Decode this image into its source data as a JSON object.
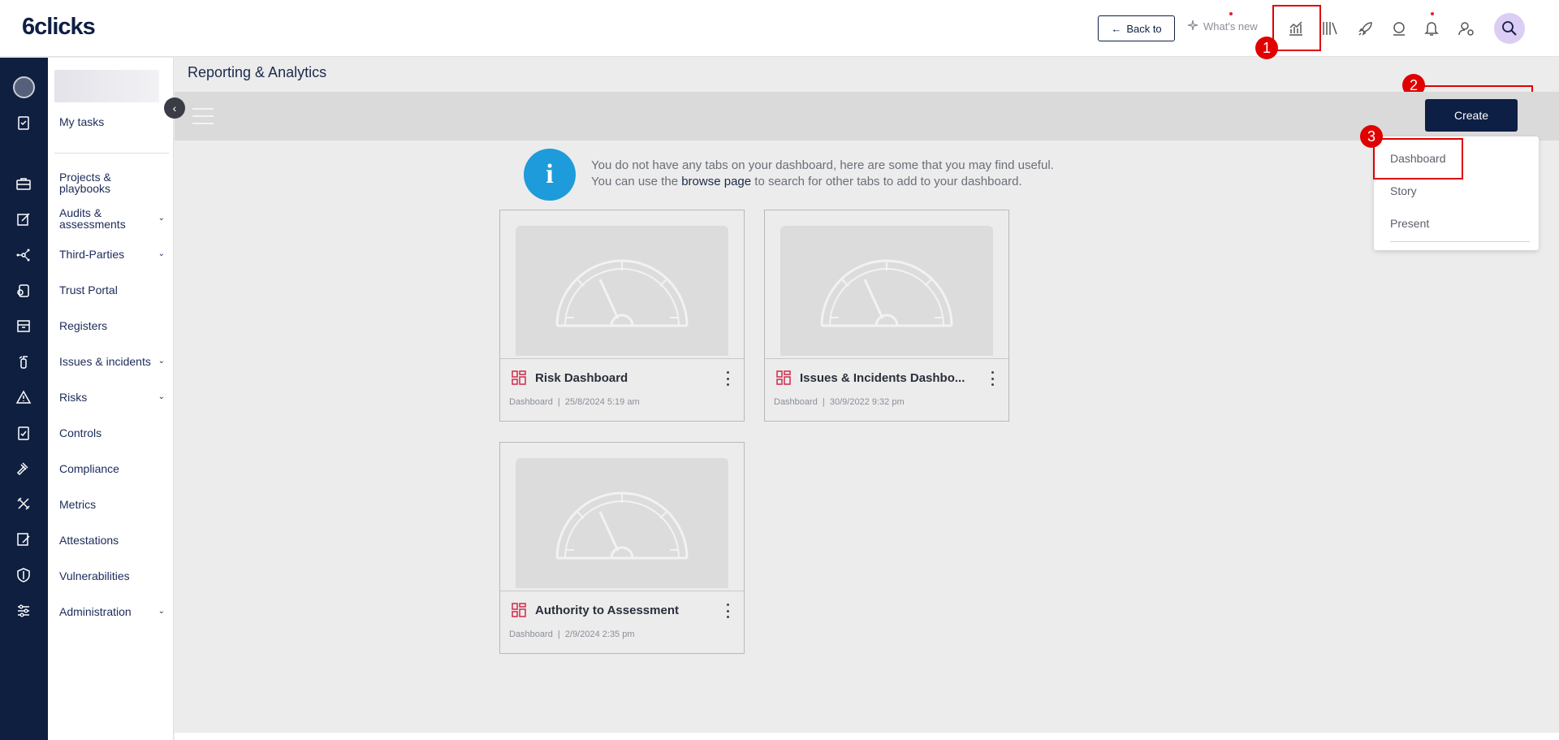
{
  "header": {
    "logo": "6clicks",
    "back_label": "Back to",
    "whats_new_label": "What's new",
    "icons": [
      "analytics-icon",
      "library-icon",
      "rocket-icon",
      "support-icon",
      "bell-icon",
      "user-settings-icon",
      "global-search-icon"
    ]
  },
  "annotations": {
    "n1": "1",
    "n2": "2",
    "n3": "3"
  },
  "sidebar": {
    "items": [
      {
        "label": "My tasks"
      },
      {
        "label": "Projects & playbooks"
      },
      {
        "label": "Audits & assessments"
      },
      {
        "label": "Third-Parties"
      },
      {
        "label": "Trust Portal"
      },
      {
        "label": "Registers"
      },
      {
        "label": "Issues & incidents"
      },
      {
        "label": "Risks"
      },
      {
        "label": "Controls"
      },
      {
        "label": "Compliance"
      },
      {
        "label": "Metrics"
      },
      {
        "label": "Attestations"
      },
      {
        "label": "Vulnerabilities"
      },
      {
        "label": "Administration"
      }
    ]
  },
  "main": {
    "title": "Reporting & Analytics",
    "create_label": "Create",
    "dropdown": [
      "Dashboard",
      "Story",
      "Present"
    ],
    "info": {
      "line1": "You do not have any tabs on your dashboard, here are some that you may find useful.",
      "line2_pre": "You can use the ",
      "line2_link": "browse page",
      "line2_post": " to search for other tabs to add to your dashboard."
    },
    "cards": [
      {
        "title": "Risk Dashboard",
        "meta": "Dashboard  |  25/8/2024 5:19 am"
      },
      {
        "title": "Issues & Incidents Dashbo...",
        "meta": "Dashboard  |  30/9/2022 9:32 pm"
      },
      {
        "title": "Authority to Assessment",
        "meta": "Dashboard  |  2/9/2024 2:35 pm"
      }
    ]
  },
  "colors": {
    "navy": "#0e1f45",
    "accent_red": "#e00000",
    "info_blue": "#1e9bdb",
    "card_icon": "#d02a4a"
  }
}
